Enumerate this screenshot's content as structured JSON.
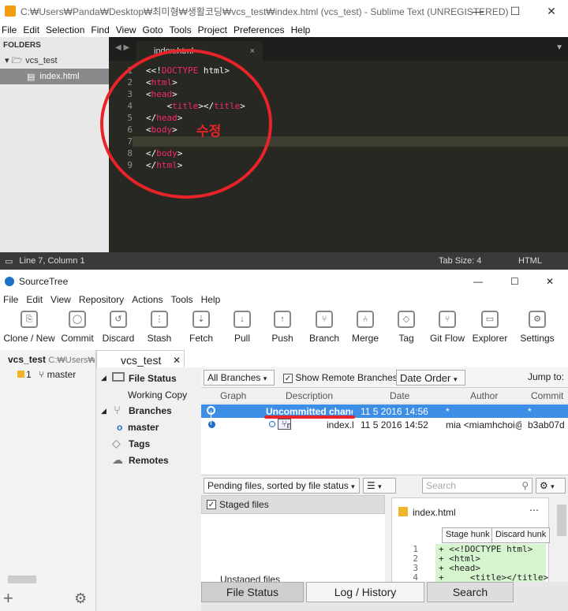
{
  "sublime": {
    "title": "C:₩Users₩Panda₩Desktop₩최미형₩생활코딩₩vcs_test₩index.html (vcs_test) - Sublime Text (UNREGISTERED)",
    "menu": [
      "File",
      "Edit",
      "Selection",
      "Find",
      "View",
      "Goto",
      "Tools",
      "Project",
      "Preferences",
      "Help"
    ],
    "sidebar": {
      "header": "FOLDERS",
      "folder": "vcs_test",
      "file": "index.html"
    },
    "tab": "index.html",
    "lines": [
      "1",
      "2",
      "3",
      "4",
      "5",
      "6",
      "7",
      "8",
      "9"
    ],
    "annotation": "수정",
    "status": {
      "position": "Line 7, Column 1",
      "tabsize": "Tab Size: 4",
      "syntax": "HTML"
    }
  },
  "sourcetree": {
    "title": "SourceTree",
    "menu": [
      "File",
      "Edit",
      "View",
      "Repository",
      "Actions",
      "Tools",
      "Help"
    ],
    "toolbar": [
      "Clone / New",
      "Commit",
      "Discard",
      "Stash",
      "Fetch",
      "Pull",
      "Push",
      "Branch",
      "Merge",
      "Tag",
      "Git Flow",
      "Explorer",
      "Settings"
    ],
    "repo": {
      "name": "vcs_test",
      "path": "C:₩Users₩P",
      "count": "1",
      "branch": "master"
    },
    "repo_tab": "vcs_test",
    "nav": {
      "file_status": "File Status",
      "working_copy": "Working Copy",
      "branches": "Branches",
      "master": "master",
      "tags": "Tags",
      "remotes": "Remotes"
    },
    "filter": {
      "branches": "All Branches",
      "show_remote": "Show Remote Branches",
      "order": "Date Order",
      "jump": "Jump to:"
    },
    "columns": {
      "graph": "Graph",
      "description": "Description",
      "date": "Date",
      "author": "Author",
      "commit": "Commit"
    },
    "rows": [
      {
        "description": "Uncommitted chang",
        "date": "11 5 2016 14:56",
        "author": "*",
        "commit": "*"
      },
      {
        "branch": "master",
        "description": "index.l",
        "date": "11 5 2016 14:52",
        "author": "mia <miamhchoi@",
        "commit": "b3ab07d"
      }
    ],
    "pending": {
      "sort": "Pending files, sorted by file status",
      "search_placeholder": "Search",
      "staged": "Staged files",
      "unstaged": "Unstaged files"
    },
    "diff": {
      "file": "index.html",
      "stage": "Stage hunk",
      "discard": "Discard hunk",
      "lines": [
        "1",
        "2",
        "3",
        "4"
      ],
      "code": [
        "+ <<!DOCTYPE html>",
        "+ <html>",
        "+ <head>",
        "+     <title></title>"
      ]
    },
    "bottom_tabs": [
      "File Status",
      "Log / History",
      "Search"
    ]
  }
}
